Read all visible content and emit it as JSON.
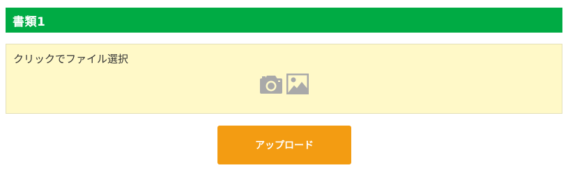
{
  "section": {
    "title": "書類1"
  },
  "dropzone": {
    "label": "クリックでファイル選択",
    "icons": [
      "camera-icon",
      "image-icon"
    ],
    "icon_color": "#a9a9a9"
  },
  "upload": {
    "button_label": "アップロード"
  },
  "colors": {
    "header_bg": "#00ab44",
    "dropzone_bg": "#fff9c8",
    "button_bg": "#f39c12"
  }
}
